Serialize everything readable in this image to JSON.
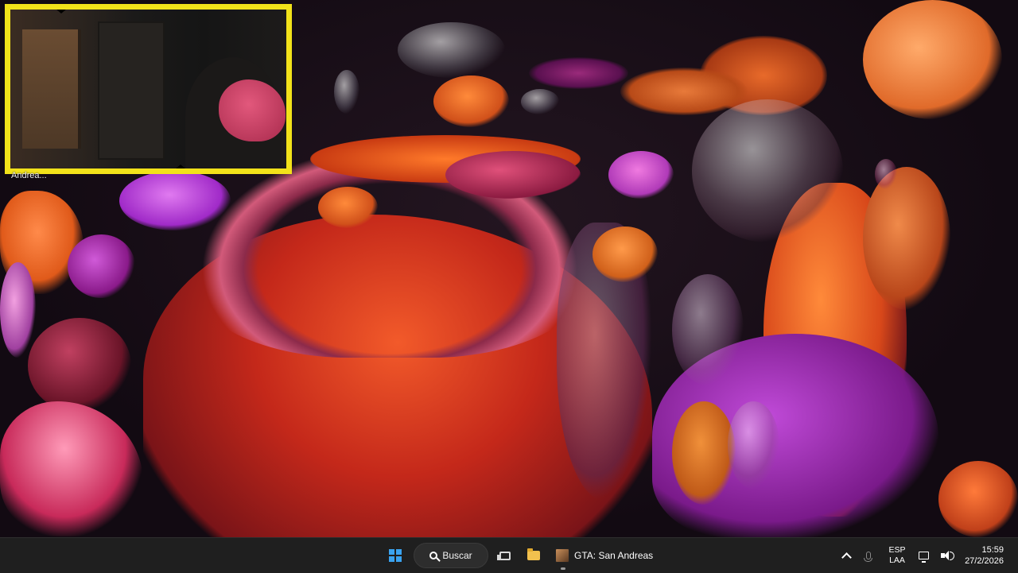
{
  "webcam": {
    "label": "Andrea..."
  },
  "taskbar": {
    "search_label": "Buscar",
    "app_title": "GTA: San Andreas",
    "icons": {
      "start": "windows-logo-icon",
      "search": "search-icon",
      "task_view": "task-view-icon",
      "explorer": "folder-icon",
      "app": "gta-icon"
    }
  },
  "tray": {
    "lang_primary": "ESP",
    "lang_secondary": "LAA",
    "time": "15:59",
    "date": "27/2/2026"
  },
  "colors": {
    "webcam_border": "#f2e21a",
    "taskbar_bg": "#1f1f1f",
    "accent": "#3aa3f0"
  }
}
